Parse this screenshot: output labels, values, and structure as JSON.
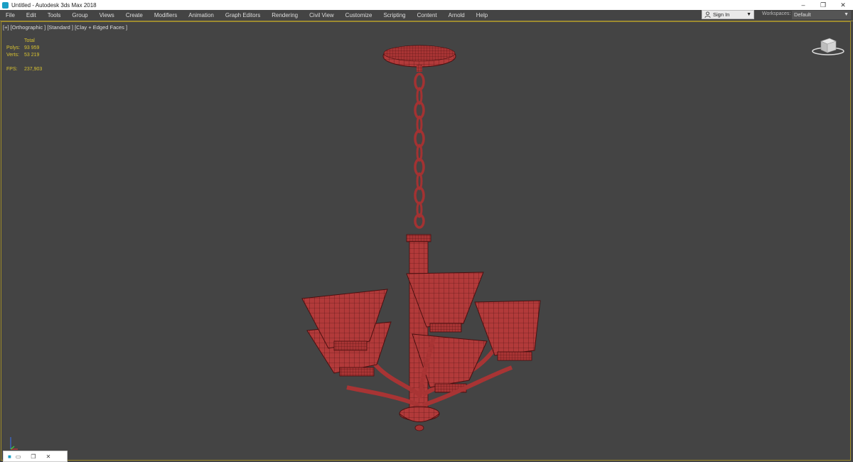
{
  "window": {
    "title": "Untitled - Autodesk 3ds Max 2018",
    "controls": [
      "–",
      "❐",
      "✕"
    ]
  },
  "menu": [
    "File",
    "Edit",
    "Tools",
    "Group",
    "Views",
    "Create",
    "Modifiers",
    "Animation",
    "Graph Editors",
    "Rendering",
    "Civil View",
    "Customize",
    "Scripting",
    "Content",
    "Arnold",
    "Help"
  ],
  "account": {
    "sign_in": "Sign In"
  },
  "workspaces": {
    "label": "Workspaces:",
    "value": "Default"
  },
  "viewport": {
    "label": "[+] [Orthographic ] [Standard ] [Clay + Edged Faces ]",
    "stats": {
      "total_label": "Total",
      "polys_label": "Polys:",
      "polys_value": "93 959",
      "verts_label": "Verts:",
      "verts_value": "53 219",
      "fps_label": "FPS:",
      "fps_value": "237,903"
    }
  },
  "colors": {
    "model": "#b23a3a",
    "wire": "#4a1010",
    "stats": "#d8c230",
    "viewport_border": "#a08c28"
  },
  "taskbar": {
    "icons": [
      "3dsmax-icon",
      "window-icon",
      "restore-icon",
      "close-icon"
    ]
  }
}
